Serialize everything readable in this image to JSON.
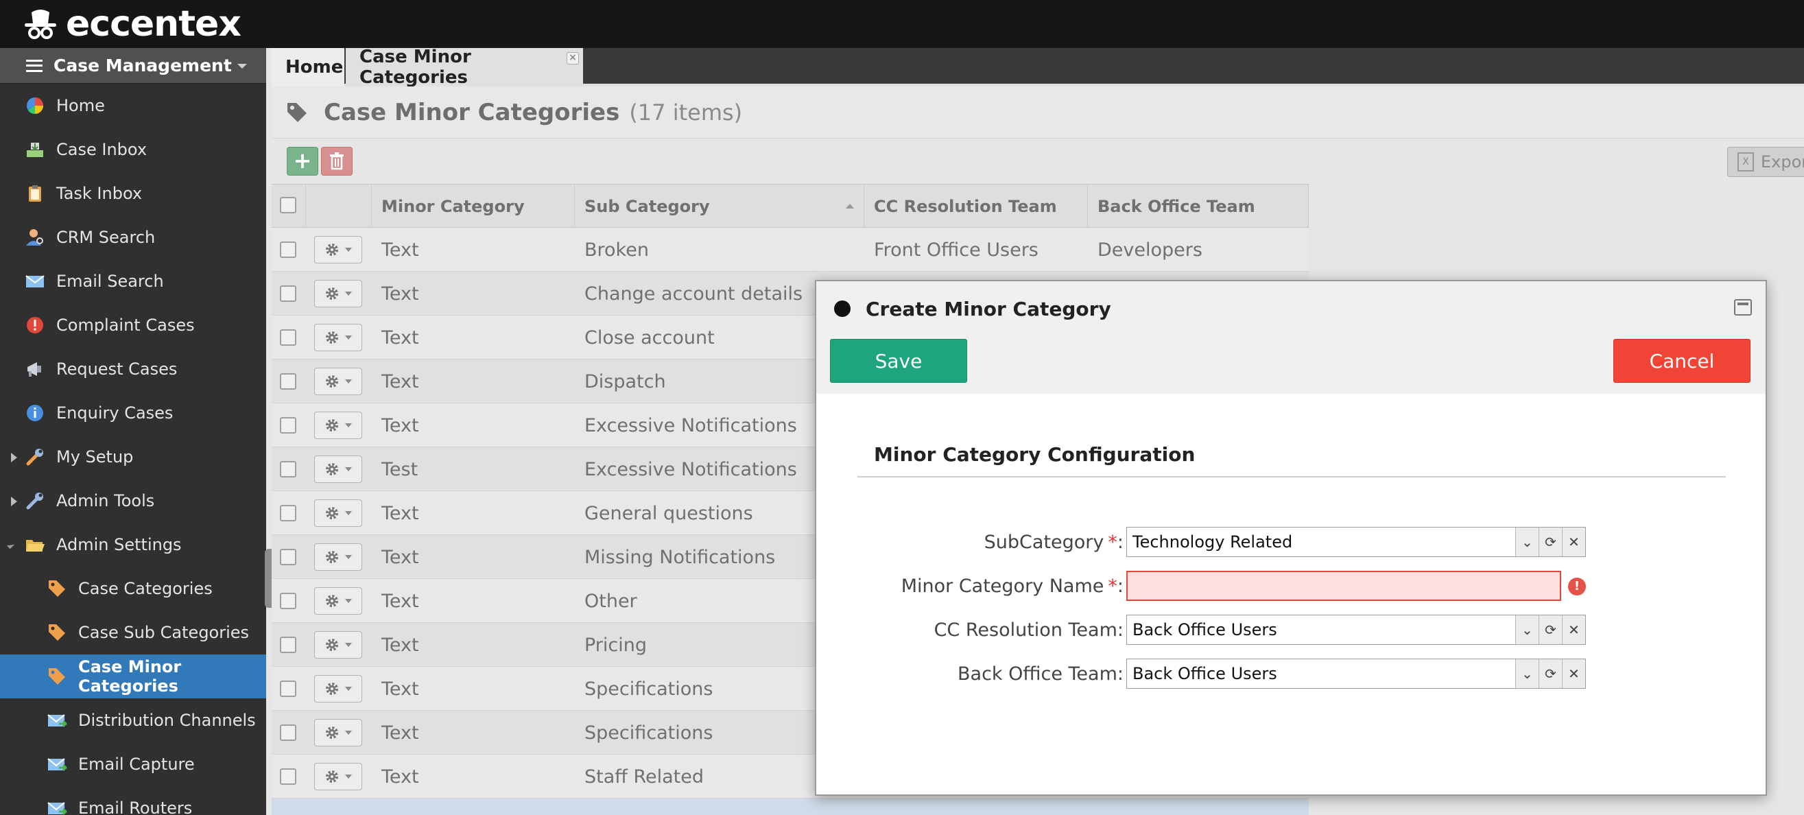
{
  "app": {
    "logo_text": "eccentex"
  },
  "sidebar": {
    "header": "Case Management",
    "items": [
      {
        "label": "Home",
        "icon": "pie-chart-icon"
      },
      {
        "label": "Case Inbox",
        "icon": "inbox-icon"
      },
      {
        "label": "Task Inbox",
        "icon": "clipboard-icon"
      },
      {
        "label": "CRM Search",
        "icon": "user-search-icon"
      },
      {
        "label": "Email Search",
        "icon": "envelope-icon"
      },
      {
        "label": "Complaint Cases",
        "icon": "alert-icon"
      },
      {
        "label": "Request Cases",
        "icon": "megaphone-icon"
      },
      {
        "label": "Enquiry Cases",
        "icon": "info-icon"
      },
      {
        "label": "My Setup",
        "icon": "wrench-icon"
      },
      {
        "label": "Admin Tools",
        "icon": "wrench-icon"
      },
      {
        "label": "Admin Settings",
        "icon": "folder-open-icon"
      },
      {
        "label": "Case Categories",
        "icon": "tag-icon"
      },
      {
        "label": "Case Sub Categories",
        "icon": "tag-icon"
      },
      {
        "label": "Case Minor Categories",
        "icon": "tag-icon"
      },
      {
        "label": "Distribution Channels",
        "icon": "mail-channel-icon"
      },
      {
        "label": "Email Capture",
        "icon": "mail-channel-icon"
      },
      {
        "label": "Email Routers",
        "icon": "mail-channel-icon"
      }
    ]
  },
  "tabs": [
    {
      "label": "Home"
    },
    {
      "label": "Case Minor Categories"
    }
  ],
  "page": {
    "title": "Case Minor Categories",
    "count": "(17 items)",
    "export_label": "Export"
  },
  "grid": {
    "columns": [
      "Minor Category",
      "Sub Category",
      "CC Resolution Team",
      "Back Office Team"
    ],
    "rows": [
      {
        "minor": "Text",
        "sub": "Broken",
        "cc": "Front Office Users",
        "bo": "Developers"
      },
      {
        "minor": "Text",
        "sub": "Change account details",
        "cc": "",
        "bo": ""
      },
      {
        "minor": "Text",
        "sub": "Close account",
        "cc": "",
        "bo": ""
      },
      {
        "minor": "Text",
        "sub": "Dispatch",
        "cc": "",
        "bo": ""
      },
      {
        "minor": "Text",
        "sub": "Excessive Notifications",
        "cc": "",
        "bo": ""
      },
      {
        "minor": "Test",
        "sub": "Excessive Notifications",
        "cc": "",
        "bo": ""
      },
      {
        "minor": "Text",
        "sub": "General questions",
        "cc": "",
        "bo": ""
      },
      {
        "minor": "Text",
        "sub": "Missing Notifications",
        "cc": "",
        "bo": ""
      },
      {
        "minor": "Text",
        "sub": "Other",
        "cc": "",
        "bo": ""
      },
      {
        "minor": "Text",
        "sub": "Pricing",
        "cc": "",
        "bo": ""
      },
      {
        "minor": "Text",
        "sub": "Specifications",
        "cc": "",
        "bo": ""
      },
      {
        "minor": "Text",
        "sub": "Specifications",
        "cc": "",
        "bo": ""
      },
      {
        "minor": "Text",
        "sub": "Staff Related",
        "cc": "",
        "bo": ""
      }
    ]
  },
  "dialog": {
    "title": "Create Minor Category",
    "save_label": "Save",
    "cancel_label": "Cancel",
    "section_title": "Minor Category Configuration",
    "required_mark": "*",
    "fields": {
      "subcategory": {
        "label": "SubCategory",
        "value": "Technology Related"
      },
      "minor_name": {
        "label": "Minor Category Name",
        "value": ""
      },
      "cc_team": {
        "label": "CC Resolution Team:",
        "value": "Back Office Users"
      },
      "bo_team": {
        "label": "Back Office Team:",
        "value": "Back Office Users"
      }
    }
  },
  "colors": {
    "topbar": "#161616",
    "sidebar": "#303030",
    "active_item": "#3179b8",
    "save": "#1fa57c",
    "cancel": "#f04437",
    "error": "#e0483b"
  }
}
